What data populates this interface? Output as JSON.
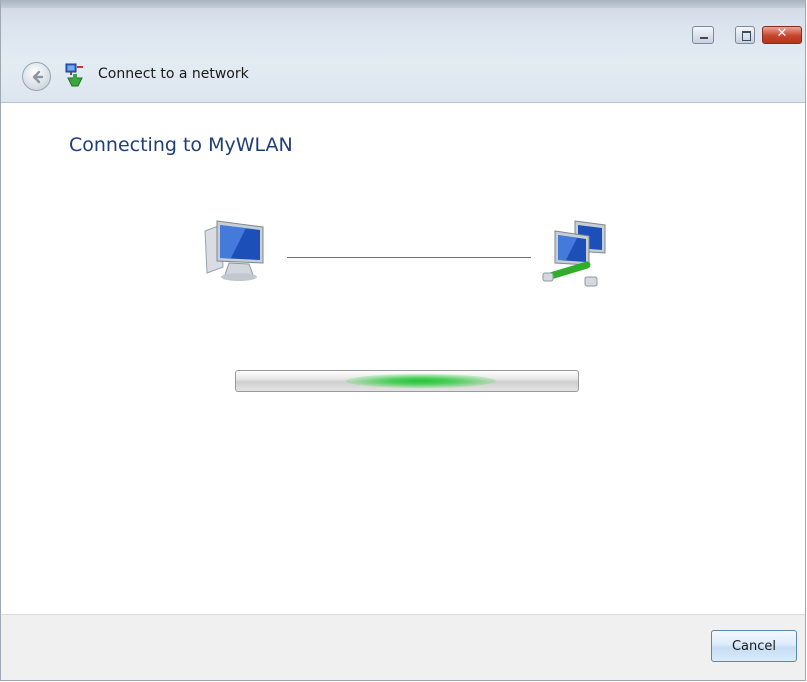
{
  "window": {
    "title": "Connect to a network",
    "close_glyph": "✕"
  },
  "main": {
    "heading": "Connecting to MyWLAN"
  },
  "progress": {
    "mode": "indeterminate",
    "glow_position": 0.54,
    "glow_color": "#2dc43c"
  },
  "footer": {
    "cancel_label": "Cancel"
  },
  "icons": {
    "back": "back-arrow-icon",
    "network": "network-connect-icon",
    "local_computer": "computer-icon",
    "remote_network": "network-computers-icon"
  },
  "colors": {
    "heading": "#1f3e78",
    "titlebar": "#dbe4ee",
    "footer": "#f0f0f0"
  }
}
